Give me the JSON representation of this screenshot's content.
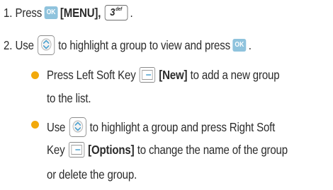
{
  "steps": [
    {
      "number": "1.",
      "text_a": "Press",
      "ok_label": "OK",
      "menu_label": "[MENU],",
      "num_key_digit": "3",
      "num_key_letters": "def",
      "text_end": "."
    },
    {
      "number": "2.",
      "text_a": "Use",
      "text_b": "to highlight a group to view and press",
      "ok_label": "OK",
      "text_end": "."
    }
  ],
  "bullets": [
    {
      "line1_a": "Press Left Soft Key",
      "line1_bold": "[New]",
      "line1_b": "to add a new group",
      "line2": "to the list."
    },
    {
      "line1_a": "Use",
      "line1_b": "to highlight a group and press Right Soft",
      "line2_a": "Key",
      "line2_bold": "[Options]",
      "line2_b": "to change the name of the group",
      "line3": "or delete the group."
    }
  ],
  "colors": {
    "text": "#2b2b2b",
    "ok_key": "#8fc3dd",
    "bullet": "#f2a90b"
  },
  "icons": {
    "nav_key": "up-down-navigation-key-icon",
    "soft_key": "soft-key-icon",
    "ok_key": "ok-key-icon",
    "num_key": "number-3-key-icon"
  }
}
